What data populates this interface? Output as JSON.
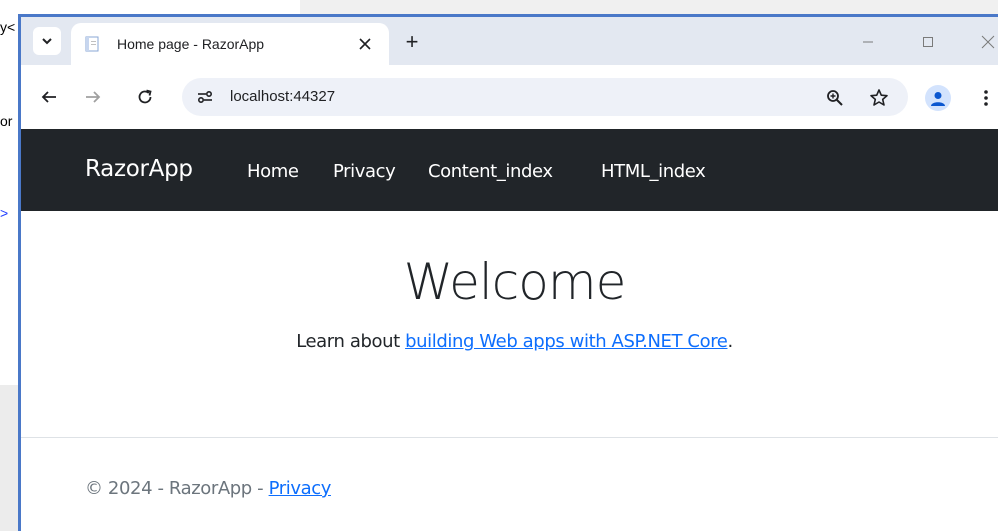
{
  "background_editor": {
    "fragments": [
      "y<",
      "or",
      ">"
    ]
  },
  "browser": {
    "tab_title": "Home page - RazorApp",
    "new_tab_symbol": "+",
    "url": "localhost:44327"
  },
  "page": {
    "brand": "RazorApp",
    "nav_links": [
      "Home",
      "Privacy",
      "Content_index",
      "HTML_index"
    ],
    "heading": "Welcome",
    "learn_prefix": "Learn about ",
    "learn_link": "building Web apps with ASP.NET Core",
    "learn_suffix": ".",
    "footer_text": "© 2024 - RazorApp - ",
    "footer_link": "Privacy"
  },
  "colors": {
    "navbar": "#212529",
    "link": "#0d6efd",
    "tabstrip": "#e3e8f1",
    "window_border": "#4a78c8"
  },
  "icons": [
    "tab-search-icon",
    "favicon-icon",
    "close-icon",
    "minimize-icon",
    "maximize-icon",
    "window-close-icon",
    "back-icon",
    "forward-icon",
    "reload-icon",
    "site-info-icon",
    "zoom-icon",
    "bookmark-star-icon",
    "profile-icon",
    "menu-icon"
  ]
}
